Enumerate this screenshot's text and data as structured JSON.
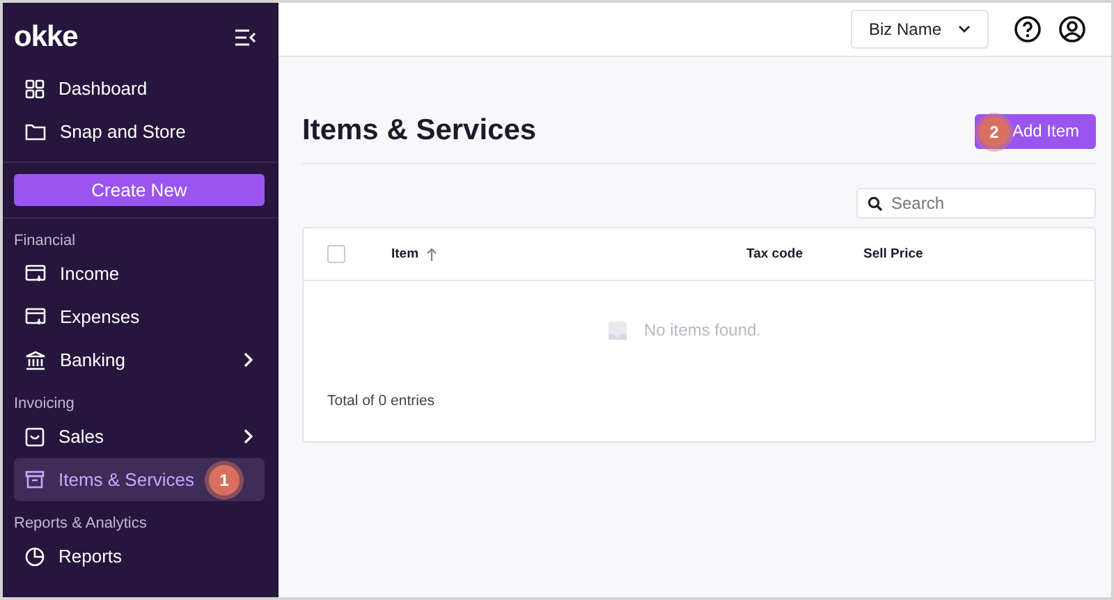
{
  "sidebar": {
    "logo": "okke",
    "top_items": [
      {
        "label": "Dashboard",
        "selected": false
      },
      {
        "label": "Snap and Store",
        "selected": false
      }
    ],
    "create_button": "Create New",
    "sections": [
      {
        "heading": "Financial",
        "items": [
          {
            "label": "Income",
            "selected": false,
            "has_submenu": false
          },
          {
            "label": "Expenses",
            "selected": false,
            "has_submenu": false
          },
          {
            "label": "Banking",
            "selected": false,
            "has_submenu": true
          }
        ]
      },
      {
        "heading": "Invoicing",
        "items": [
          {
            "label": "Sales",
            "selected": false,
            "has_submenu": true
          },
          {
            "label": "Items & Services",
            "selected": true,
            "has_submenu": false,
            "step_badge": "1"
          }
        ]
      },
      {
        "heading": "Reports & Analytics",
        "items": [
          {
            "label": "Reports",
            "selected": false,
            "has_submenu": false
          }
        ]
      }
    ]
  },
  "header": {
    "business_select": "Biz Name"
  },
  "page": {
    "title": "Items & Services",
    "add_button": "Add Item",
    "add_step_badge": "2",
    "search": {
      "placeholder": "Search"
    },
    "table": {
      "select_all_checked": false,
      "columns": [
        {
          "label": "Item",
          "sorted": true
        },
        {
          "label": "Tax code",
          "sorted": false
        },
        {
          "label": "Sell Price",
          "sorted": false
        }
      ],
      "empty_message": "No items found.",
      "footer": "Total of 0 entries"
    }
  }
}
